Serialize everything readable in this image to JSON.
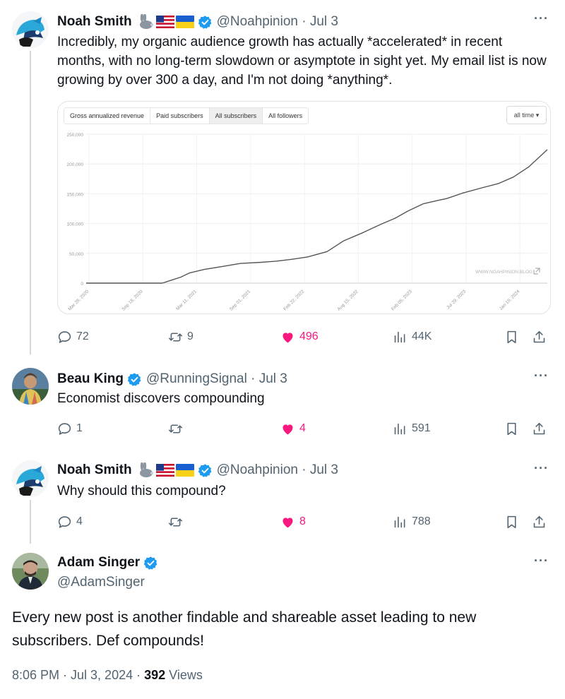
{
  "tweets": [
    {
      "name": "Noah Smith",
      "emoji": [
        "rabbit",
        "us-flag",
        "ukraine-flag"
      ],
      "handle": "@Noahpinion · Jul 3",
      "text": "Incredibly, my organic audience growth has actually *accelerated* in recent months, with no long-term slowdown or asymptote in sight yet. My email list is now growing by over 300 a day, and I'm not doing *anything*.",
      "replies": "72",
      "retweets": "9",
      "likes": "496",
      "views": "44K"
    },
    {
      "name": "Beau King",
      "handle": "@RunningSignal · Jul 3",
      "text": "Economist discovers compounding",
      "replies": "1",
      "retweets": "",
      "likes": "4",
      "views": "591"
    },
    {
      "name": "Noah Smith",
      "emoji": [
        "rabbit",
        "us-flag",
        "ukraine-flag"
      ],
      "handle": "@Noahpinion · Jul 3",
      "text": "Why should this compound?",
      "replies": "4",
      "retweets": "",
      "likes": "8",
      "views": "788"
    }
  ],
  "main_tweet": {
    "name": "Adam Singer",
    "handle": "@AdamSinger",
    "text": "Every new post is another findable and shareable asset leading to new subscribers. Def compounds!",
    "time": "8:06 PM · Jul 3, 2024 · ",
    "views_count": "392",
    "views_label": " Views"
  },
  "more_label": "···",
  "card": {
    "tabs": [
      "Gross annualized revenue",
      "Paid subscribers",
      "All subscribers",
      "All followers"
    ],
    "active_tab": "All subscribers",
    "range": "all time ▾",
    "watermark": "WWW.NOAHPINION.BLOG"
  },
  "colors": {
    "accent": "#1d9bf0",
    "like": "#f91880",
    "muted": "#536471",
    "line": "#555555"
  },
  "chart_data": {
    "type": "line",
    "title": "",
    "xlabel": "",
    "ylabel": "",
    "yticks": [
      "250,000",
      "200,000",
      "150,000",
      "100,000",
      "50,000",
      "0"
    ],
    "ytick_values": [
      250000,
      200000,
      150000,
      100000,
      50000,
      0
    ],
    "ylim": [
      0,
      250000
    ],
    "xticks": [
      "Mar 28, 2020",
      "Sep 18, 2020",
      "Mar 11, 2021",
      "Sep 01, 2021",
      "Feb 22, 2022",
      "Aug 15, 2022",
      "Feb 05, 2023",
      "Jul 29, 2023",
      "Jan 19, 2024"
    ],
    "grid": true,
    "series": [
      {
        "x": [
          "2020-03-28",
          "2020-06-20",
          "2020-09-18",
          "2020-12-10",
          "2021-01-10",
          "2021-02-10",
          "2021-03-11",
          "2021-05-01",
          "2021-07-01",
          "2021-09-01",
          "2021-11-10",
          "2022-01-01",
          "2022-02-22",
          "2022-04-15",
          "2022-06-20",
          "2022-08-15",
          "2022-10-20",
          "2022-12-20",
          "2023-02-05",
          "2023-03-20",
          "2023-05-10",
          "2023-07-01",
          "2023-07-29",
          "2023-09-20",
          "2023-11-25",
          "2024-01-19",
          "2024-03-10",
          "2024-05-01",
          "2024-07-03"
        ],
        "values": [
          0,
          0,
          0,
          0,
          5000,
          10000,
          17000,
          23000,
          28000,
          33000,
          35000,
          37000,
          40000,
          44000,
          53000,
          71000,
          85000,
          99000,
          109000,
          121000,
          133000,
          139000,
          142000,
          151000,
          160000,
          167000,
          178000,
          195000,
          224000
        ]
      }
    ]
  }
}
